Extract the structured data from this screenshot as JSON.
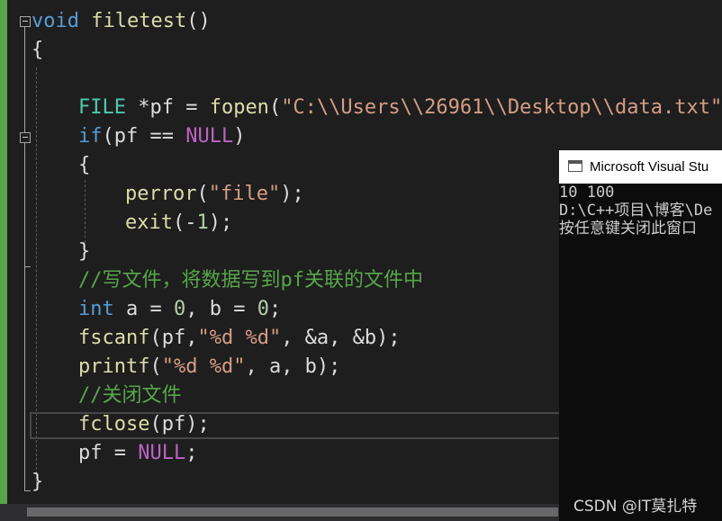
{
  "code": {
    "lines": [
      [
        {
          "t": "void",
          "c": "kw"
        },
        {
          "t": " ",
          "c": "txt"
        },
        {
          "t": "filetest",
          "c": "fn"
        },
        {
          "t": "()",
          "c": "txt"
        }
      ],
      [
        {
          "t": "{",
          "c": "txt"
        }
      ],
      [],
      [
        {
          "t": "FILE",
          "c": "typ"
        },
        {
          "t": " *pf = ",
          "c": "txt"
        },
        {
          "t": "fopen",
          "c": "fn"
        },
        {
          "t": "(",
          "c": "txt"
        },
        {
          "t": "\"C:\\\\Users\\\\26961\\\\Desktop\\\\data.txt\"",
          "c": "str"
        },
        {
          "t": ",",
          "c": "txt"
        }
      ],
      [
        {
          "t": "if",
          "c": "kw"
        },
        {
          "t": "(pf == ",
          "c": "txt"
        },
        {
          "t": "NULL",
          "c": "mac"
        },
        {
          "t": ")",
          "c": "txt"
        }
      ],
      [
        {
          "t": "{",
          "c": "txt"
        }
      ],
      [
        {
          "t": "perror",
          "c": "fn"
        },
        {
          "t": "(",
          "c": "txt"
        },
        {
          "t": "\"file\"",
          "c": "str"
        },
        {
          "t": ");",
          "c": "txt"
        }
      ],
      [
        {
          "t": "exit",
          "c": "fn"
        },
        {
          "t": "(-",
          "c": "txt"
        },
        {
          "t": "1",
          "c": "num"
        },
        {
          "t": ");",
          "c": "txt"
        }
      ],
      [
        {
          "t": "}",
          "c": "txt"
        }
      ],
      [
        {
          "t": "//写文件，将数据写到pf关联的文件中",
          "c": "cmt"
        }
      ],
      [
        {
          "t": "int",
          "c": "kw"
        },
        {
          "t": " a = ",
          "c": "txt"
        },
        {
          "t": "0",
          "c": "num"
        },
        {
          "t": ", b = ",
          "c": "txt"
        },
        {
          "t": "0",
          "c": "num"
        },
        {
          "t": ";",
          "c": "txt"
        }
      ],
      [
        {
          "t": "fscanf",
          "c": "fn"
        },
        {
          "t": "(pf,",
          "c": "txt"
        },
        {
          "t": "\"%d %d\"",
          "c": "str"
        },
        {
          "t": ", &a, &b);",
          "c": "txt"
        }
      ],
      [
        {
          "t": "printf",
          "c": "fn"
        },
        {
          "t": "(",
          "c": "txt"
        },
        {
          "t": "\"%d %d\"",
          "c": "str"
        },
        {
          "t": ", a, b);",
          "c": "txt"
        }
      ],
      [
        {
          "t": "//关闭文件",
          "c": "cmt"
        }
      ],
      [
        {
          "t": "fclose",
          "c": "fn"
        },
        {
          "t": "(pf);",
          "c": "txt"
        }
      ],
      [
        {
          "t": "pf = ",
          "c": "txt"
        },
        {
          "t": "NULL",
          "c": "mac"
        },
        {
          "t": ";",
          "c": "txt"
        }
      ],
      [
        {
          "t": "}",
          "c": "txt"
        }
      ]
    ]
  },
  "console": {
    "title": "Microsoft Visual Stu",
    "lines": [
      "10 100",
      "D:\\C++项目\\博客\\De",
      "按任意键关闭此窗口"
    ]
  },
  "watermark": "CSDN @IT莫扎特",
  "icons": {
    "fold_collapse": "fold-minus-icon",
    "console_window": "console-window-icon"
  },
  "colors": {
    "editor_bg": "#1e1e1e",
    "keyword": "#569cd6",
    "function": "#dcdcaa",
    "string": "#d69d85",
    "macro": "#bd63c5",
    "number": "#b5cea8",
    "comment": "#57a64a",
    "type": "#4ec9b0",
    "change_bar": "#57a64a"
  }
}
